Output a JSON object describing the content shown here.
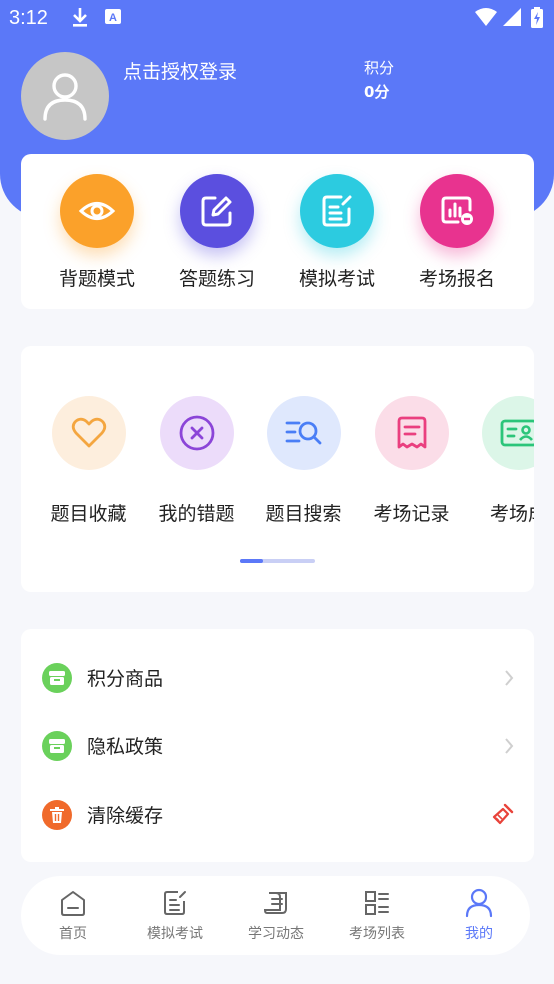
{
  "status_bar": {
    "time": "3:12"
  },
  "profile": {
    "login_text": "点击授权登录",
    "points_label": "积分",
    "points_value": "0分"
  },
  "main_actions": [
    {
      "label": "背题模式",
      "icon": "eye-icon",
      "color": "#fba12a"
    },
    {
      "label": "答题练习",
      "icon": "edit-icon",
      "color": "#5b4fdf"
    },
    {
      "label": "模拟考试",
      "icon": "exam-paper-icon",
      "color": "#2ccbe0"
    },
    {
      "label": "考场报名",
      "icon": "signup-board-icon",
      "color": "#e8338f"
    }
  ],
  "tools": [
    {
      "label": "题目收藏",
      "icon": "heart-icon",
      "color": "#f4a640",
      "bg": "#fdeedd"
    },
    {
      "label": "我的错题",
      "icon": "wrong-x-icon",
      "color": "#8b45d8",
      "bg": "#ecdcfa"
    },
    {
      "label": "题目搜索",
      "icon": "search-list-icon",
      "color": "#4a7ef6",
      "bg": "#dfe8fd"
    },
    {
      "label": "考场记录",
      "icon": "receipt-icon",
      "color": "#ea3f7f",
      "bg": "#fbdde8"
    },
    {
      "label": "考场成",
      "icon": "id-card-icon",
      "color": "#2bc57a",
      "bg": "#dcf6e8"
    }
  ],
  "menu": [
    {
      "label": "积分商品",
      "icon": "goods-icon",
      "color": "#6ad15b"
    },
    {
      "label": "隐私政策",
      "icon": "policy-icon",
      "color": "#6ad15b"
    },
    {
      "label": "清除缓存",
      "icon": "trash-icon",
      "color": "#f06a2b"
    }
  ],
  "tabbar": [
    {
      "label": "首页",
      "icon": "home-icon",
      "active": false
    },
    {
      "label": "模拟考试",
      "icon": "exam-icon",
      "active": false
    },
    {
      "label": "学习动态",
      "icon": "scroll-icon",
      "active": false
    },
    {
      "label": "考场列表",
      "icon": "list-icon",
      "active": false
    },
    {
      "label": "我的",
      "icon": "user-icon",
      "active": true
    }
  ],
  "colors": {
    "primary": "#5b78f8"
  }
}
